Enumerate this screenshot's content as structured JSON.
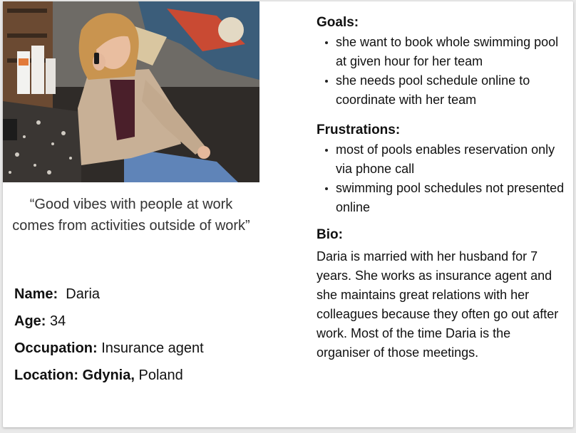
{
  "photo": {
    "alt": "portrait-photo"
  },
  "quote": "“Good vibes with people at work comes from activities outside of work”",
  "facts": {
    "name_label": "Name:",
    "name_value": "Daria",
    "age_label": "Age:",
    "age_value": "34",
    "occupation_label": "Occupation:",
    "occupation_value": "Insurance agent",
    "location_label": "Location:",
    "location_city": "Gdynia,",
    "location_country": "Poland"
  },
  "goals": {
    "title": "Goals:",
    "items": [
      "she want to book whole swimming pool at given hour for her team",
      "she needs pool schedule online to coordinate with her team"
    ]
  },
  "frustrations": {
    "title": "Frustrations:",
    "items": [
      "most of pools enables reservation only via phone call",
      "swimming pool schedules not presented online"
    ]
  },
  "bio": {
    "title": "Bio:",
    "text": "Daria is married with her husband for 7 years. She works as insurance agent and she maintains great relations with her colleagues because they often go out after work. Most of the time Daria is the organiser of those meetings."
  }
}
